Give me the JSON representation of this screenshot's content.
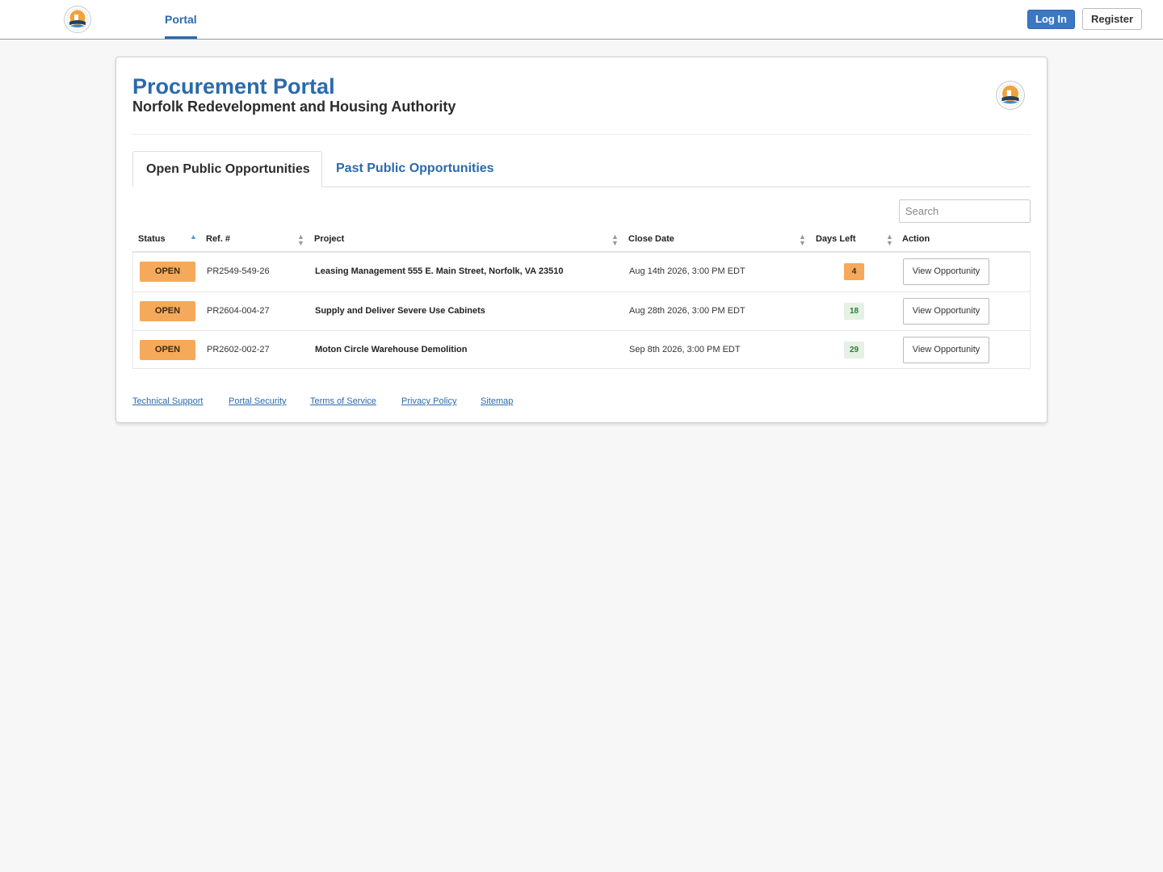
{
  "nav": {
    "logo_icon": "nrha-logo-icon",
    "portal_label": "Portal",
    "login_label": "Log In",
    "register_label": "Register"
  },
  "header": {
    "title": "Procurement Portal",
    "subtitle": "Norfolk Redevelopment and Housing Authority"
  },
  "tabs": [
    {
      "label": "Open Public Opportunities",
      "active": true
    },
    {
      "label": "Past Public Opportunities",
      "active": false
    }
  ],
  "search": {
    "placeholder": "Search",
    "value": ""
  },
  "table": {
    "columns": [
      "Status",
      "Ref. #",
      "Project",
      "Close Date",
      "Days Left",
      "Action"
    ],
    "rows": [
      {
        "status": "OPEN",
        "ref": "PR2549-549-26",
        "project": "Leasing Management 555 E. Main Street, Norfolk, VA 23510",
        "close_date": "Aug 14th 2026, 3:00 PM EDT",
        "days_left": "4",
        "action": "View Opportunity"
      },
      {
        "status": "OPEN",
        "ref": "PR2604-004-27",
        "project": "Supply and Deliver Severe Use Cabinets",
        "close_date": "Aug 28th 2026, 3:00 PM EDT",
        "days_left": "18",
        "action": "View Opportunity"
      },
      {
        "status": "OPEN",
        "ref": "PR2602-002-27",
        "project": "Moton Circle Warehouse Demolition",
        "close_date": "Sep 8th 2026, 3:00 PM EDT",
        "days_left": "29",
        "action": "View Opportunity"
      }
    ]
  },
  "footer": {
    "links": [
      "Technical Support",
      "Portal Security",
      "Terms of Service",
      "Privacy Policy",
      "Sitemap"
    ]
  },
  "colors": {
    "brand_blue": "#2a6aad",
    "login_button": "#3a78c3",
    "status_open": "#f5a95a",
    "days_ok_bg": "#e4f1e4",
    "days_ok_text": "#2e7d32"
  }
}
